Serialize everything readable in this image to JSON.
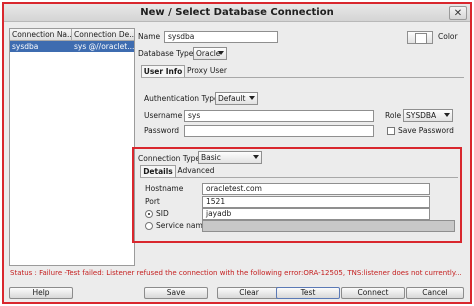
{
  "window": {
    "title": "New / Select Database Connection",
    "close_label": "✕"
  },
  "connections": {
    "headers": [
      "Connection Na...",
      "Connection De..."
    ],
    "rows": [
      {
        "name": "sysdba",
        "details": "sys @//oraclet..."
      }
    ]
  },
  "form": {
    "name_label": "Name",
    "name_value": "sysdba",
    "color_label": "Color",
    "db_type_label": "Database Type",
    "db_type_value": "Oracle",
    "tabs": [
      "User Info",
      "Proxy User"
    ],
    "auth_type_label": "Authentication Type",
    "auth_type_value": "Default",
    "username_label": "Username",
    "username_value": "sys",
    "role_label": "Role",
    "role_value": "SYSDBA",
    "password_label": "Password",
    "password_value": "",
    "save_password_label": "Save Password",
    "connection_type_label": "Connection Type",
    "connection_type_value": "Basic",
    "conn_tabs": [
      "Details",
      "Advanced"
    ],
    "hostname_label": "Hostname",
    "hostname_value": "oracletest.com",
    "port_label": "Port",
    "port_value": "1521",
    "sid_label": "SID",
    "sid_value": "jayadb",
    "service_name_label": "Service name",
    "service_name_value": ""
  },
  "status": {
    "text": "Status : Failure -Test failed: Listener refused the connection with the following error:ORA-12505, TNS:listener does not currently..."
  },
  "buttons": {
    "help": "Help",
    "save": "Save",
    "clear": "Clear",
    "test": "Test",
    "connect": "Connect",
    "cancel": "Cancel"
  },
  "colors": {
    "accent_red": "#d9272e",
    "selection_blue": "#3e6cb0",
    "status_red": "#c41e1e"
  }
}
